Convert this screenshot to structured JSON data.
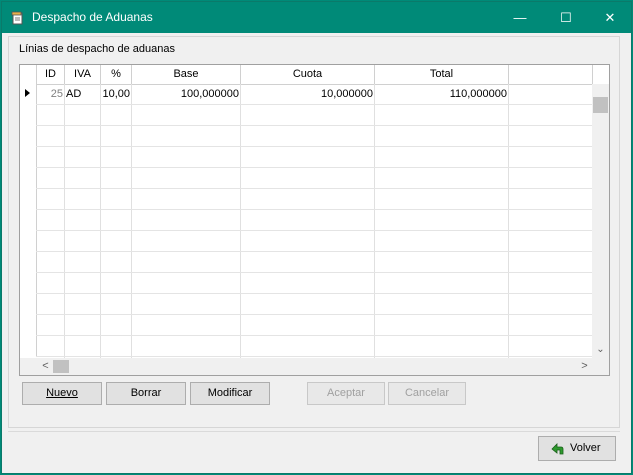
{
  "window": {
    "title": "Despacho de Aduanas",
    "minimize": "—",
    "maximize": "☐",
    "close": "✕"
  },
  "group": {
    "label": "Línias de despacho de aduanas"
  },
  "grid": {
    "columns": [
      "ID",
      "IVA",
      "%",
      "Base",
      "Cuota",
      "Total"
    ],
    "rows": [
      {
        "id": "25",
        "iva": "AD",
        "pct": "10,00",
        "base": "100,000000",
        "cuota": "10,000000",
        "total": "110,000000"
      }
    ]
  },
  "buttons": {
    "nuevo": "Nuevo",
    "borrar": "Borrar",
    "modificar": "Modificar",
    "aceptar": "Aceptar",
    "cancelar": "Cancelar",
    "volver": "Volver"
  },
  "scroll": {
    "up": "⌃",
    "down": "⌄",
    "left": "<",
    "right": ">"
  }
}
